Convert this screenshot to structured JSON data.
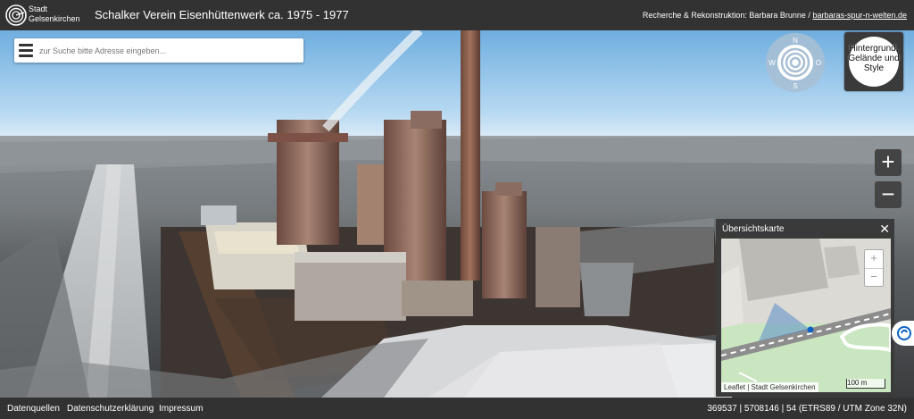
{
  "header": {
    "logo_line1": "Stadt",
    "logo_line2": "Gelsenkirchen",
    "title": "Schalker Verein Eisenhüttenwerk ca. 1975 - 1977",
    "credits_prefix": "Recherche & Rekonstruktion: Barbara Brunne / ",
    "credits_link": "barbaras-spur-n-welten.de"
  },
  "search": {
    "placeholder": "zur Suche bitte Adresse eingeben..."
  },
  "compass": {
    "north": "N",
    "south": "S",
    "west": "W",
    "east": "O"
  },
  "background_button": {
    "line1": "Hintergrund,",
    "line2": "Gelände und",
    "line3": "Style"
  },
  "zoom": {
    "in": "+",
    "out": "−"
  },
  "overview": {
    "title": "Übersichtskarte",
    "close": "✕",
    "zoom_in": "+",
    "zoom_out": "−",
    "attribution": "Leaflet | Stadt Gelsenkirchen",
    "scale": "100 m"
  },
  "footer": {
    "links": [
      "Datenquellen",
      "Datenschutzerklärung",
      "Impressum"
    ],
    "coordinates": "369537  |  5708146  |  54  (ETRS89 / UTM Zone 32N)"
  },
  "colors": {
    "bar": "#323232",
    "sky": "#8fc3ea",
    "accent": "#0b62c4"
  },
  "icons": {
    "logo": "city-logo-icon",
    "menu": "hamburger-menu-icon",
    "compass": "compass-icon",
    "side": "location-icon"
  }
}
